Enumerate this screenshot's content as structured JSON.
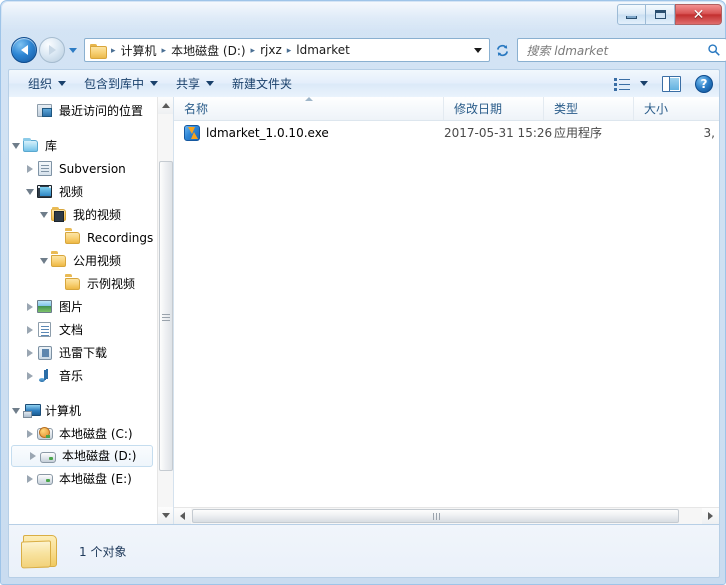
{
  "window": {
    "controls": {
      "minimize": "—",
      "maximize": "□",
      "close": "✕"
    }
  },
  "nav": {
    "back_title": "后退",
    "forward_title": "前进",
    "history_title": "最近浏览的位置",
    "refresh_title": "刷新",
    "breadcrumb": [
      "计算机",
      "本地磁盘 (D:)",
      "rjxz",
      "ldmarket"
    ],
    "separator": "▸"
  },
  "search": {
    "placeholder": "搜索 ldmarket",
    "icon": "search-icon"
  },
  "toolbar": {
    "items": [
      {
        "label": "组织",
        "has_caret": true
      },
      {
        "label": "包含到库中",
        "has_caret": true
      },
      {
        "label": "共享",
        "has_caret": true
      },
      {
        "label": "新建文件夹",
        "has_caret": false
      }
    ],
    "view_icon": "view-options-icon",
    "pane_icon": "preview-pane-icon",
    "help_icon": "help-icon",
    "help_label": "?"
  },
  "sidebar": {
    "items": [
      {
        "label": "最近访问的位置",
        "indent": 1,
        "expander": "none",
        "icon": "recent-places-icon"
      },
      {
        "label": "",
        "indent": 0,
        "expander": "none",
        "icon": "spacer"
      },
      {
        "label": "库",
        "indent": 0,
        "expander": "open",
        "icon": "library-folder-icon"
      },
      {
        "label": "Subversion",
        "indent": 1,
        "expander": "closed",
        "icon": "subversion-icon"
      },
      {
        "label": "视频",
        "indent": 1,
        "expander": "open",
        "icon": "video-library-icon"
      },
      {
        "label": "我的视频",
        "indent": 2,
        "expander": "open",
        "icon": "video-folder-icon"
      },
      {
        "label": "Recordings",
        "indent": 3,
        "expander": "none",
        "icon": "folder-icon"
      },
      {
        "label": "公用视频",
        "indent": 2,
        "expander": "open",
        "icon": "folder-icon"
      },
      {
        "label": "示例视频",
        "indent": 3,
        "expander": "none",
        "icon": "folder-icon"
      },
      {
        "label": "图片",
        "indent": 1,
        "expander": "closed",
        "icon": "pictures-icon"
      },
      {
        "label": "文档",
        "indent": 1,
        "expander": "closed",
        "icon": "documents-icon"
      },
      {
        "label": "迅雷下载",
        "indent": 1,
        "expander": "closed",
        "icon": "thunder-download-icon"
      },
      {
        "label": "音乐",
        "indent": 1,
        "expander": "closed",
        "icon": "music-icon"
      },
      {
        "label": "",
        "indent": 0,
        "expander": "none",
        "icon": "spacer"
      },
      {
        "label": "计算机",
        "indent": 0,
        "expander": "open",
        "icon": "computer-icon"
      },
      {
        "label": "本地磁盘 (C:)",
        "indent": 1,
        "expander": "closed",
        "icon": "system-disk-icon"
      },
      {
        "label": "本地磁盘 (D:)",
        "indent": 1,
        "expander": "closed",
        "icon": "disk-icon",
        "selected": true
      },
      {
        "label": "本地磁盘 (E:)",
        "indent": 1,
        "expander": "closed",
        "icon": "disk-icon"
      }
    ]
  },
  "filelist": {
    "columns": [
      {
        "key": "name",
        "label": "名称",
        "sorted": true
      },
      {
        "key": "date",
        "label": "修改日期"
      },
      {
        "key": "type",
        "label": "类型"
      },
      {
        "key": "size",
        "label": "大小"
      }
    ],
    "rows": [
      {
        "name": "ldmarket_1.0.10.exe",
        "date": "2017-05-31 15:26",
        "type": "应用程序",
        "size": "3,",
        "icon": "exe-bolt-icon"
      }
    ]
  },
  "status": {
    "text": "1 个对象",
    "icon": "folder-icon"
  },
  "colors": {
    "frame": "#c9dcf0",
    "accent": "#2878c0",
    "close_button": "#c32f2f",
    "column_header_text": "#2a5c8a",
    "exe_icon_blue": "#2f86d6",
    "exe_icon_bolt": "#f7a21c"
  }
}
